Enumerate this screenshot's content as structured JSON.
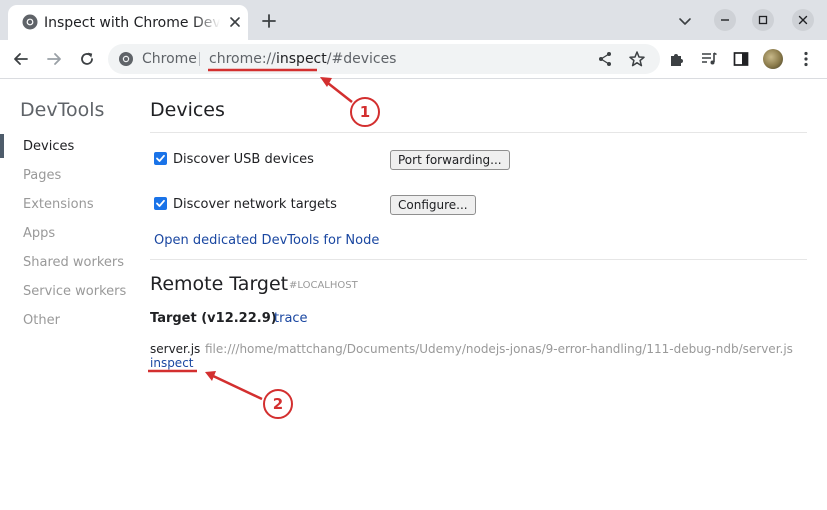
{
  "browser": {
    "tab_title": "Inspect with Chrome Developer Tools",
    "omnibox": {
      "label": "Chrome",
      "url_scheme": "chrome://",
      "url_host": "inspect",
      "url_path": "/#devices"
    }
  },
  "sidebar": {
    "title": "DevTools",
    "items": [
      {
        "label": "Devices"
      },
      {
        "label": "Pages"
      },
      {
        "label": "Extensions"
      },
      {
        "label": "Apps"
      },
      {
        "label": "Shared workers"
      },
      {
        "label": "Service workers"
      },
      {
        "label": "Other"
      }
    ]
  },
  "devices": {
    "title": "Devices",
    "usb": {
      "label": "Discover USB devices",
      "button": "Port forwarding..."
    },
    "network": {
      "label": "Discover network targets",
      "button": "Configure..."
    },
    "node_link": "Open dedicated DevTools for Node"
  },
  "remote": {
    "title": "Remote Target",
    "tag": "#LOCALHOST",
    "target_name": "Target (v12.22.9)",
    "trace_link": "trace",
    "file_name": "server.js",
    "file_path": "file:///home/mattchang/Documents/Udemy/nodejs-jonas/9-error-handling/111-debug-ndb/server.js",
    "inspect_link": "inspect"
  },
  "annotations": {
    "marker_1": "1",
    "marker_2": "2",
    "color": "#d32f2f"
  },
  "colors": {
    "accent": "#1a73e8",
    "link": "#1a47a1"
  }
}
